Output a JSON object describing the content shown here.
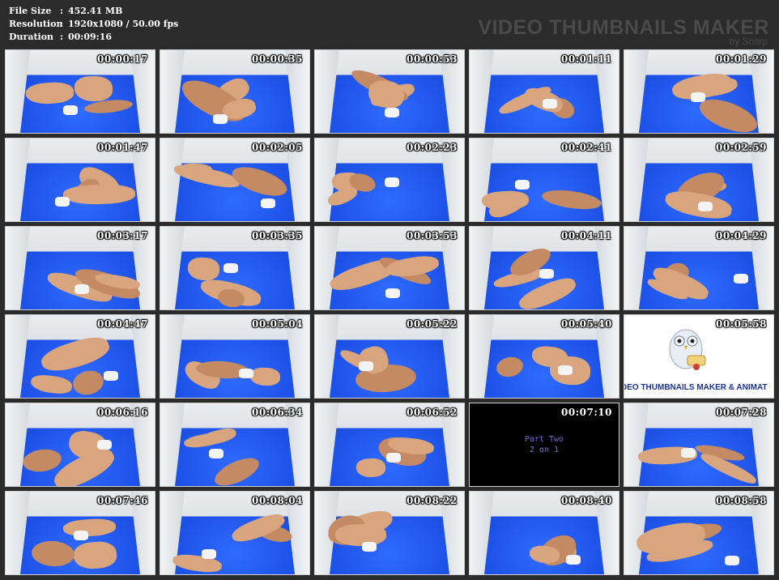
{
  "header": {
    "info": [
      {
        "label": "File Size",
        "sep": ":",
        "value": "452.41 MB"
      },
      {
        "label": "Resolution",
        "sep": ":",
        "value": "1920x1080 / 50.00 fps"
      },
      {
        "label": "Duration",
        "sep": ":",
        "value": "00:09:16"
      }
    ],
    "brand": "VIDEO THUMBNAILS MAKER",
    "brand_sub": "by Scorp"
  },
  "thumbnails": [
    {
      "time": "00:00:17"
    },
    {
      "time": "00:00:35"
    },
    {
      "time": "00:00:53"
    },
    {
      "time": "00:01:11"
    },
    {
      "time": "00:01:29"
    },
    {
      "time": "00:01:47"
    },
    {
      "time": "00:02:05"
    },
    {
      "time": "00:02:23"
    },
    {
      "time": "00:02:41"
    },
    {
      "time": "00:02:59"
    },
    {
      "time": "00:03:17"
    },
    {
      "time": "00:03:35"
    },
    {
      "time": "00:03:53"
    },
    {
      "time": "00:04:11"
    },
    {
      "time": "00:04:29"
    },
    {
      "time": "00:04:47"
    },
    {
      "time": "00:05:04"
    },
    {
      "time": "00:05:22"
    },
    {
      "time": "00:05:40"
    },
    {
      "time": "00:05:58"
    },
    {
      "time": "00:06:16"
    },
    {
      "time": "00:06:34"
    },
    {
      "time": "00:06:52"
    },
    {
      "time": "00:07:10"
    },
    {
      "time": "00:07:28"
    },
    {
      "time": "00:07:46"
    },
    {
      "time": "00:08:04"
    },
    {
      "time": "00:08:22"
    },
    {
      "time": "00:08:40"
    },
    {
      "time": "00:08:58"
    }
  ],
  "black_frame": {
    "line1": "Part Two",
    "line2": "2 on 1"
  },
  "logo_frame": {
    "text": "DEO THUMBNAILS MAKER & ANIMAT"
  }
}
